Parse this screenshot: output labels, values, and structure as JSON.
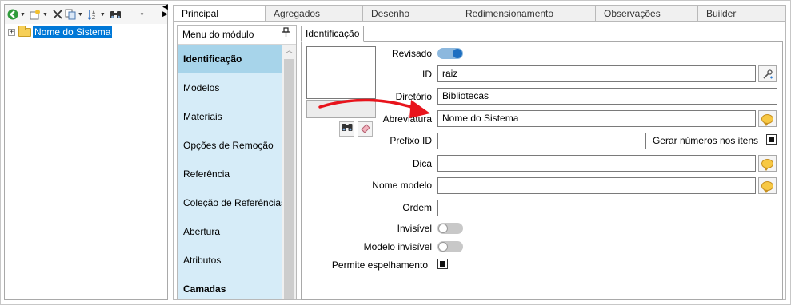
{
  "toolbar": {
    "icons": [
      "back-icon",
      "new-item-icon",
      "delete-icon",
      "copy-icon",
      "sort-icon",
      "find-icon"
    ]
  },
  "tree": {
    "expander": "+",
    "root_label": "Nome do Sistema"
  },
  "tabs": [
    {
      "label": "Principal",
      "active": true
    },
    {
      "label": "Agregados"
    },
    {
      "label": "Desenho"
    },
    {
      "label": "Redimensionamento"
    },
    {
      "label": "Observações"
    },
    {
      "label": "Builder"
    }
  ],
  "module_menu": {
    "title": "Menu do módulo",
    "items": [
      {
        "label": "Identificação",
        "selected": true
      },
      {
        "label": "Modelos"
      },
      {
        "label": "Materiais"
      },
      {
        "label": "Opções de Remoção"
      },
      {
        "label": "Referência"
      },
      {
        "label": "Coleção de Referências"
      },
      {
        "label": "Abertura"
      },
      {
        "label": "Atributos"
      },
      {
        "label": "Camadas",
        "bold": true
      }
    ]
  },
  "identification": {
    "tab_label": "Identificação",
    "revisado_label": "Revisado",
    "revisado_on": true,
    "id_label": "ID",
    "id_value": "raiz",
    "diretorio_label": "Diretório",
    "diretorio_value": "Bibliotecas",
    "abreviatura_label": "Abreviatura",
    "abreviatura_value": "Nome do Sistema",
    "prefixo_label": "Prefixo ID",
    "prefixo_value": "",
    "gerar_label": "Gerar números nos itens",
    "gerar_checked": true,
    "dica_label": "Dica",
    "dica_value": "",
    "nome_modelo_label": "Nome modelo",
    "nome_modelo_value": "",
    "ordem_label": "Ordem",
    "ordem_value": "",
    "invisivel_label": "Invisível",
    "invisivel_on": false,
    "modelo_invisivel_label": "Modelo invisível",
    "modelo_invisivel_on": false,
    "espelhamento_label": "Permite espelhamento",
    "espelhamento_checked": true
  },
  "colors": {
    "accent": "#1e6fc1",
    "tree_selection": "#0078d7",
    "menu_background": "#d6ecf8",
    "menu_selected": "#a7d4ea",
    "annotation_arrow": "#e8141c"
  }
}
